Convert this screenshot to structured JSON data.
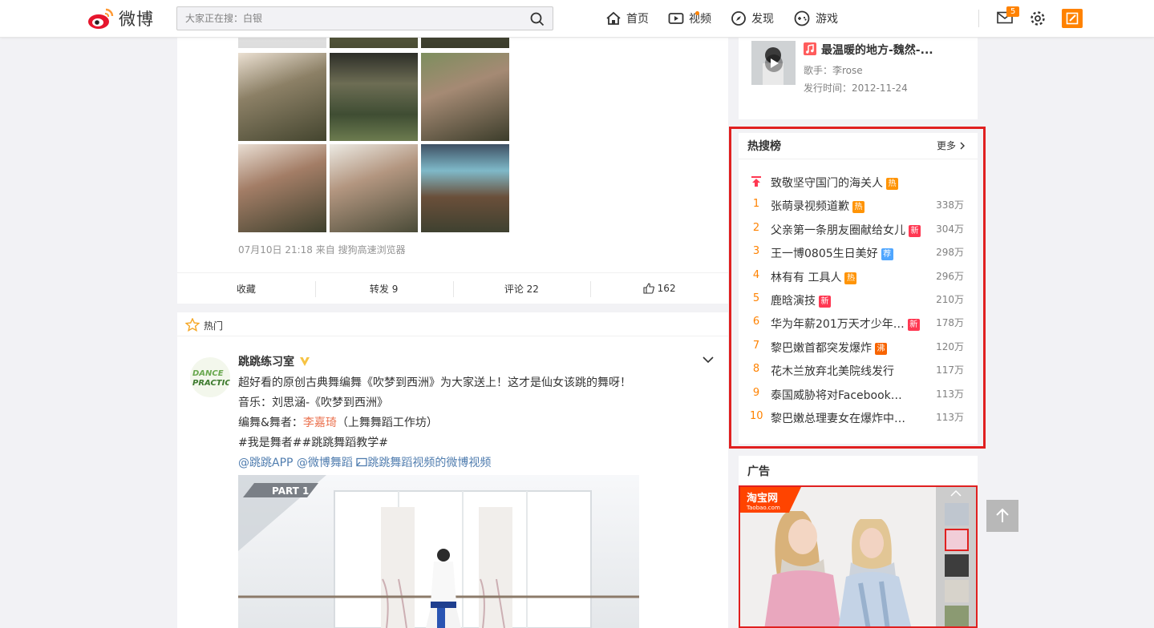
{
  "brand": {
    "name": "微博"
  },
  "search": {
    "placeholder": "大家正在搜：白银"
  },
  "nav": {
    "items": [
      {
        "label": "首页"
      },
      {
        "label": "视频"
      },
      {
        "label": "发现"
      },
      {
        "label": "游戏"
      }
    ],
    "message_count": "5"
  },
  "photo_post": {
    "time_source": "07月10日 21:18  来自 搜狗高速浏览器",
    "actions": {
      "favorite": "收藏",
      "repost": "转发 9",
      "comment": "评论 22",
      "like": "162"
    }
  },
  "hot_section": {
    "label": "热门"
  },
  "post": {
    "author": "跳跳练习室",
    "lines": {
      "l1": "超好看的原创古典舞编舞《吹梦到西洲》为大家送上！这才是仙女该跳的舞呀！",
      "l2": "音乐：刘思涵-《吹梦到西洲》",
      "l3_prefix": "编舞&舞者：",
      "l3_name": "李嘉琦",
      "l3_suffix": "（上舞舞蹈工作坊）",
      "l4": "#我是舞者##跳跳舞蹈教学#",
      "l5": "@跳跳APP @微博舞蹈 ",
      "l5_link": "跳跳舞蹈视频的微博视频"
    },
    "video_label": "PART 1"
  },
  "music": {
    "title": "最温暖的地方-魏然-...",
    "singer": "歌手：李rose",
    "release": "发行时间：2012-11-24"
  },
  "hot_search": {
    "title": "热搜榜",
    "more": "更多",
    "pinned": {
      "text": "致敬坚守国门的海关人",
      "tag": "热"
    },
    "items": [
      {
        "rank": "1",
        "text": "张萌录视频道歉",
        "tag": "热",
        "count": "338万"
      },
      {
        "rank": "2",
        "text": "父亲第一条朋友圈献给女儿",
        "tag": "新",
        "count": "304万"
      },
      {
        "rank": "3",
        "text": "王一博0805生日美好",
        "tag": "荐",
        "count": "298万"
      },
      {
        "rank": "4",
        "text": "林有有 工具人",
        "tag": "热",
        "count": "296万"
      },
      {
        "rank": "5",
        "text": "鹿晗演技",
        "tag": "新",
        "count": "210万"
      },
      {
        "rank": "6",
        "text": "华为年薪201万天才少年…",
        "tag": "新",
        "count": "178万"
      },
      {
        "rank": "7",
        "text": "黎巴嫩首都突发爆炸",
        "tag": "沸",
        "count": "120万"
      },
      {
        "rank": "8",
        "text": "花木兰放弃北美院线发行",
        "tag": "",
        "count": "117万"
      },
      {
        "rank": "9",
        "text": "泰国威胁将对Facebook…",
        "tag": "",
        "count": "113万"
      },
      {
        "rank": "10",
        "text": "黎巴嫩总理妻女在爆炸中…",
        "tag": "",
        "count": "113万"
      }
    ],
    "tag_colors": {
      "热": "#ff9406",
      "新": "#ff3852",
      "荐": "#4fa6ff",
      "沸": "#f86400"
    }
  },
  "ad": {
    "title": "广告",
    "taobao": "淘宝网",
    "taobao_sub": "Taobao.com"
  },
  "colors": {
    "accent": "#ff8200",
    "highlight_frame": "#e02020",
    "link": "#507daf"
  }
}
